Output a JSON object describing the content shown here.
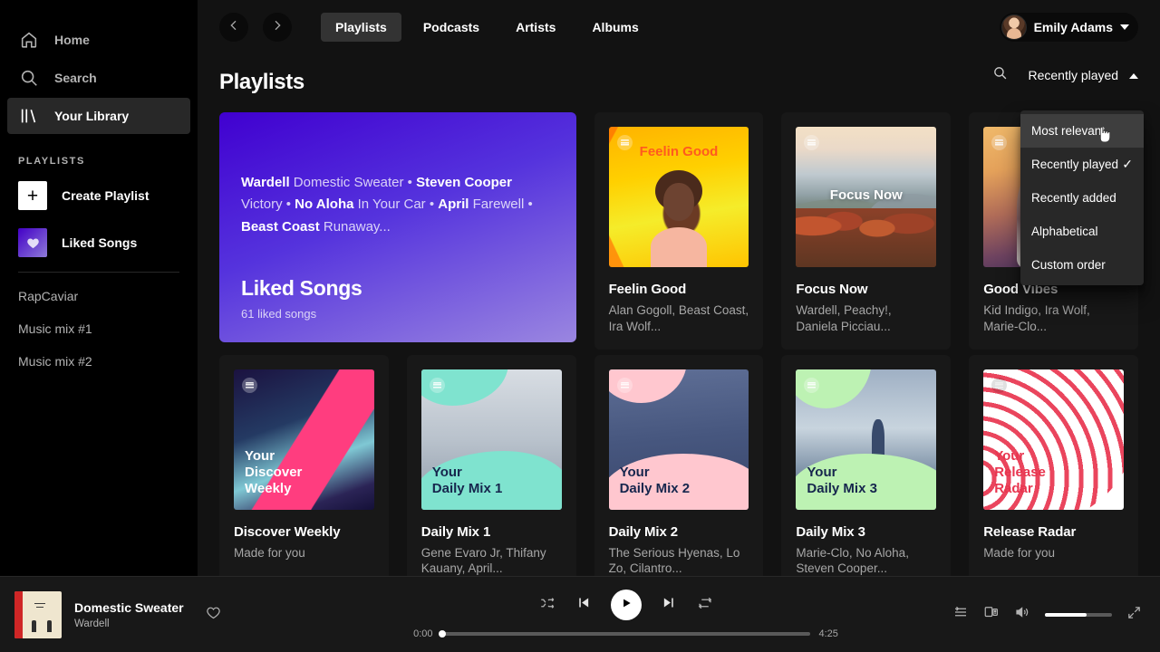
{
  "sidebar": {
    "nav": [
      {
        "label": "Home",
        "icon": "home-icon",
        "active": false
      },
      {
        "label": "Search",
        "icon": "search-icon",
        "active": false
      },
      {
        "label": "Your Library",
        "icon": "library-icon",
        "active": true
      }
    ],
    "section_label": "PLAYLISTS",
    "create_playlist": "Create Playlist",
    "liked_songs": "Liked Songs",
    "playlists": [
      "RapCaviar",
      "Music mix #1",
      "Music mix #2"
    ]
  },
  "topbar": {
    "back_icon": "chevron-left-icon",
    "forward_icon": "chevron-right-icon",
    "tabs": [
      {
        "label": "Playlists",
        "active": true
      },
      {
        "label": "Podcasts",
        "active": false
      },
      {
        "label": "Artists",
        "active": false
      },
      {
        "label": "Albums",
        "active": false
      }
    ],
    "user": {
      "name": "Emily Adams",
      "caret": "chevron-down-icon"
    }
  },
  "page": {
    "title": "Playlists",
    "search_icon": "search-icon",
    "sort_label": "Recently played",
    "sort_caret": "chevron-up-icon"
  },
  "dropdown": {
    "open": true,
    "items": [
      {
        "label": "Most relevant",
        "checked": false,
        "hovered": true
      },
      {
        "label": "Recently played",
        "checked": true,
        "hovered": false
      },
      {
        "label": "Recently added",
        "checked": false,
        "hovered": false
      },
      {
        "label": "Alphabetical",
        "checked": false,
        "hovered": false
      },
      {
        "label": "Custom order",
        "checked": false,
        "hovered": false
      }
    ],
    "check_glyph": "✓"
  },
  "hero": {
    "tracks": [
      {
        "artist": "Wardell",
        "song": "Domestic Sweater"
      },
      {
        "artist": "Steven Cooper",
        "song": "Victory"
      },
      {
        "artist": "No Aloha",
        "song": "In Your Car"
      },
      {
        "artist": "April",
        "song": "Farewell"
      },
      {
        "artist": "Beast Coast",
        "song": "Runaway..."
      }
    ],
    "separator": " • ",
    "title": "Liked Songs",
    "subtitle": "61 liked songs"
  },
  "cards_row1": [
    {
      "title": "Feelin Good",
      "subtitle": "Alan Gogoll, Beast Coast, Ira Wolf...",
      "cover_caption": "Feelin Good",
      "cover": "c-feelin"
    },
    {
      "title": "Focus Now",
      "subtitle": "Wardell, Peachy!, Daniela Picciau...",
      "cover_caption": "Focus Now",
      "cover": "c-focus"
    },
    {
      "title": "Good Vibes",
      "subtitle": "Kid Indigo, Ira Wolf, Marie-Clo...",
      "cover_caption": "",
      "cover": "c-good"
    }
  ],
  "cards_row2": [
    {
      "title": "Discover Weekly",
      "subtitle": "Made for you",
      "cover_caption": "Your\nDiscover\nWeekly",
      "cover": "c-discover"
    },
    {
      "title": "Daily Mix 1",
      "subtitle": "Gene Evaro Jr, Thifany Kauany, April...",
      "cover_caption": "Your\nDaily Mix 1",
      "cover": "c-dm1"
    },
    {
      "title": "Daily Mix 2",
      "subtitle": "The Serious Hyenas, Lo Zo, Cilantro...",
      "cover_caption": "Your\nDaily Mix 2",
      "cover": "c-dm2"
    },
    {
      "title": "Daily Mix 3",
      "subtitle": "Marie-Clo, No Aloha, Steven Cooper...",
      "cover_caption": "Your\nDaily Mix 3",
      "cover": "c-dm3"
    },
    {
      "title": "Release Radar",
      "subtitle": "Made for you",
      "cover_caption": "Your\nRelease\nRadar",
      "cover": "c-radar"
    }
  ],
  "player": {
    "track_title": "Domestic Sweater",
    "track_artist": "Wardell",
    "like_icon": "heart-icon",
    "shuffle_icon": "shuffle-icon",
    "prev_icon": "previous-icon",
    "play_icon": "play-icon",
    "next_icon": "next-icon",
    "repeat_icon": "repeat-icon",
    "time_current": "0:00",
    "time_total": "4:25",
    "progress_percent": 0,
    "queue_icon": "queue-icon",
    "devices_icon": "devices-icon",
    "volume_icon": "volume-icon",
    "volume_percent": 62,
    "fullscreen_icon": "fullscreen-icon"
  },
  "colors": {
    "sidebar_bg": "#000000",
    "main_bg": "#121212",
    "card_bg": "#181818",
    "player_bg": "#181818",
    "menu_bg": "#282828",
    "menu_hover": "#3e3e3e",
    "text_primary": "#ffffff",
    "text_muted": "#b3b3b3",
    "hero_gradient_from": "#4000d0",
    "hero_gradient_to": "#9a86e0"
  }
}
